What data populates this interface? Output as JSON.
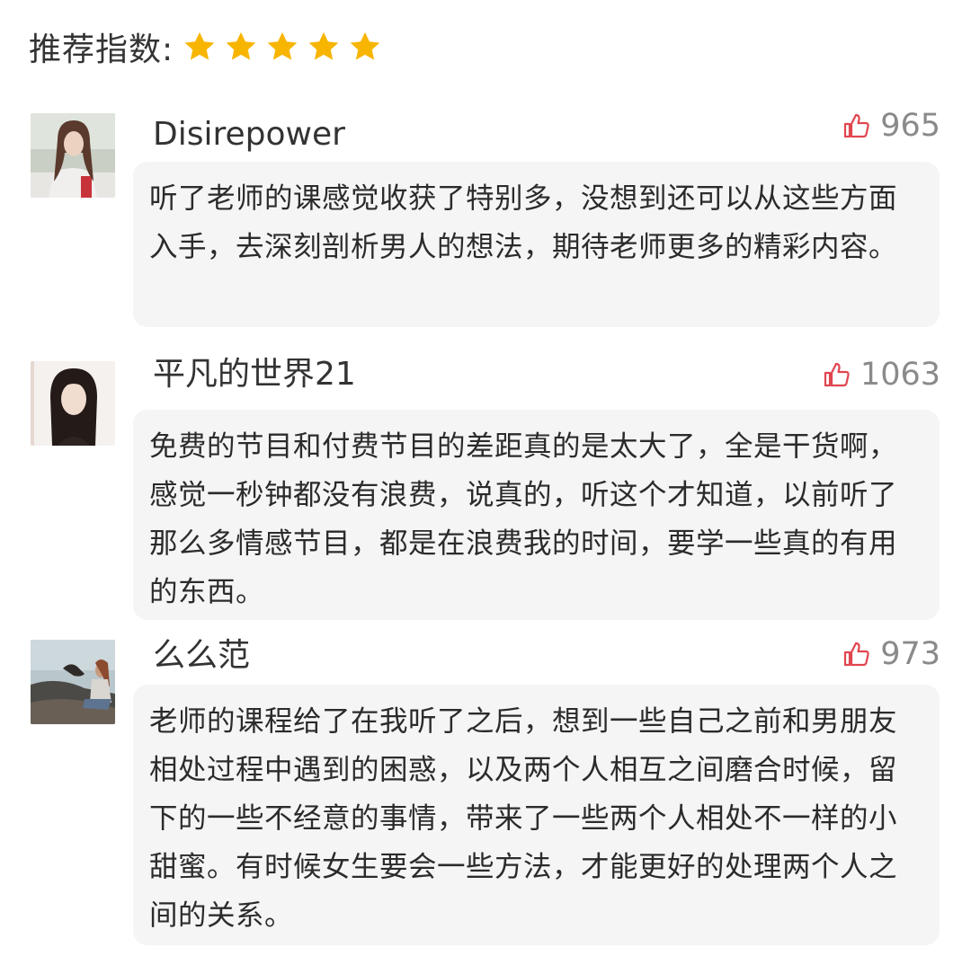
{
  "rating": {
    "label": "推荐指数:",
    "stars": 5,
    "star_color": "#f7b500"
  },
  "comments": [
    {
      "username": "Disirepower",
      "likes": "965",
      "text": "听了老师的课感觉收获了特别多，没想到还可以从这些方面入手，去深刻剖析男人的想法，期待老师更多的精彩内容。"
    },
    {
      "username": "平凡的世界21",
      "likes": "1063",
      "text": "免费的节目和付费节目的差距真的是太大了，全是干货啊，感觉一秒钟都没有浪费，说真的，听这个才知道，以前听了那么多情感节目，都是在浪费我的时间，要学一些真的有用的东西。"
    },
    {
      "username": "么么范",
      "likes": "973",
      "text": "老师的课程给了在我听了之后，想到一些自己之前和男朋友相处过程中遇到的困惑，以及两个人相互之间磨合时候，留下的一些不经意的事情，带来了一些两个人相处不一样的小甜蜜。有时候女生要会一些方法，才能更好的处理两个人之间的关系。"
    }
  ],
  "colors": {
    "like_icon": "#e0464f",
    "bubble_bg": "#f5f5f5",
    "meta_text": "#8a8a8a"
  },
  "icons": {
    "star": "star-icon",
    "like": "thumbs-up-icon"
  }
}
